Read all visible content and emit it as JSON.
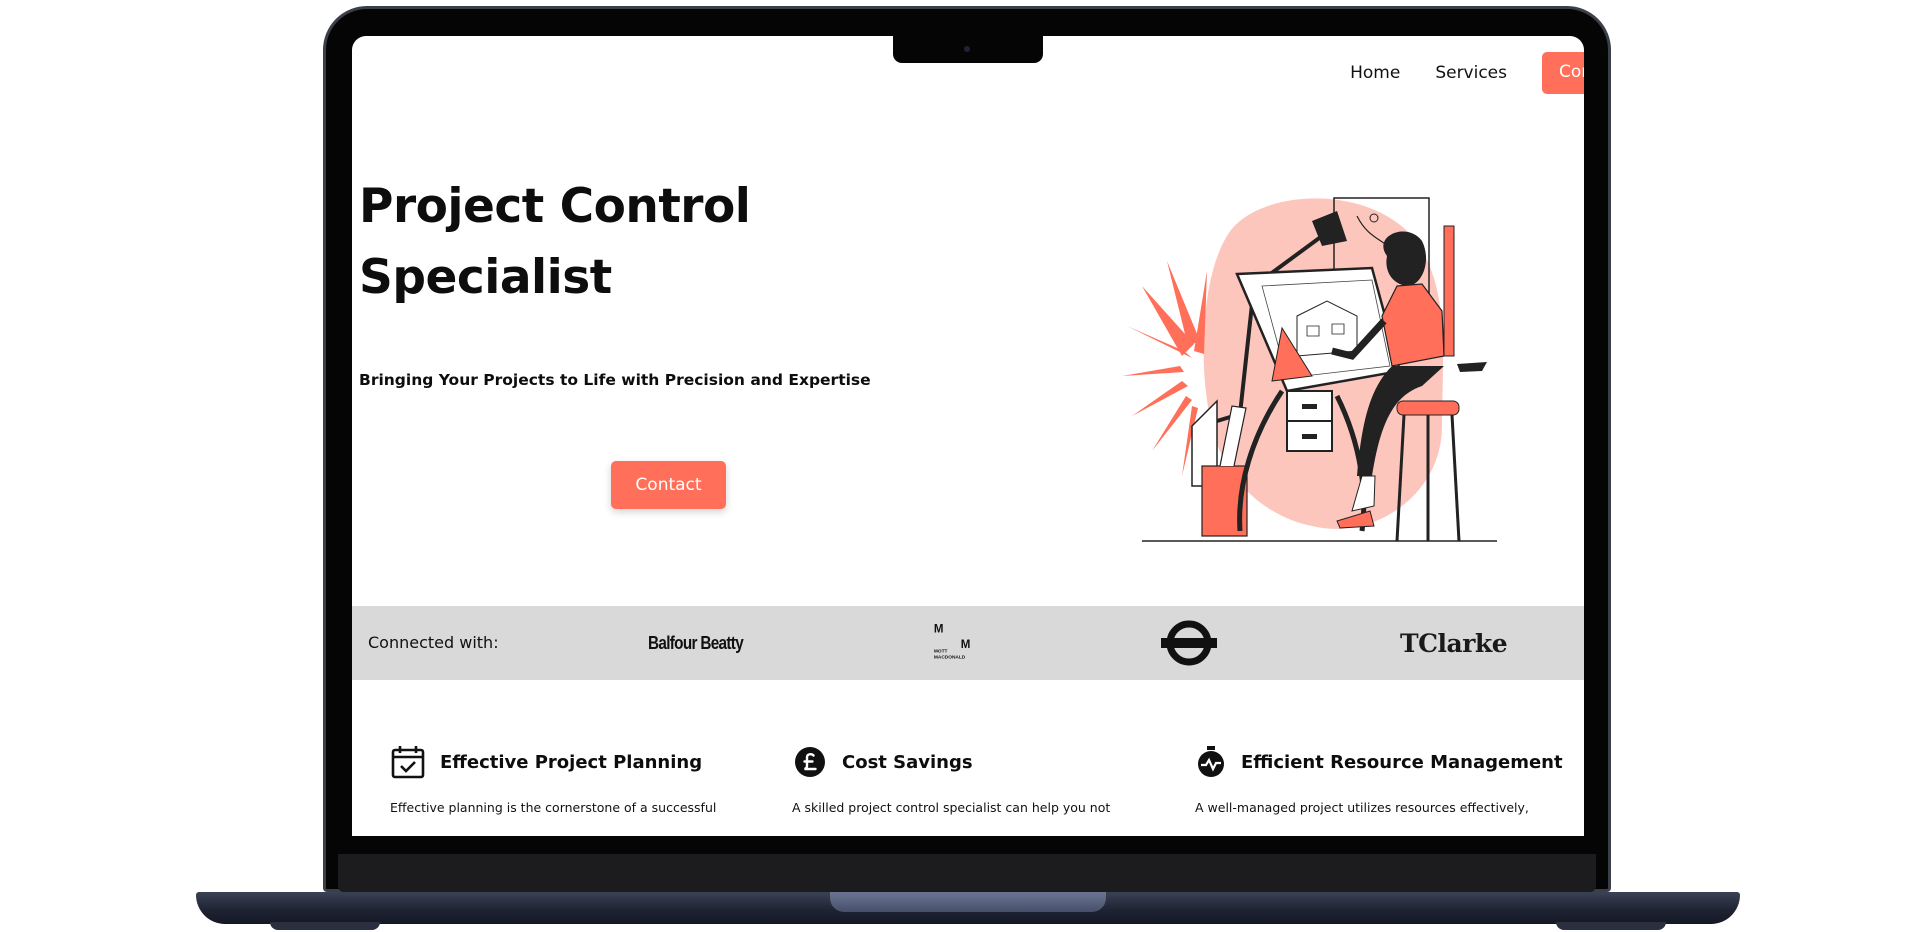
{
  "nav": {
    "home": "Home",
    "services": "Services",
    "contact": "Contact"
  },
  "hero": {
    "title_line1": "Project Control",
    "title_line2": "Specialist",
    "subtitle": "Bringing Your Projects to Life with Precision and Expertise",
    "contact_button": "Contact"
  },
  "partners": {
    "label": "Connected with:",
    "balfour": "Balfour Beatty",
    "mott_m": "M",
    "mott_text1": "MOTT",
    "mott_text2": "MACDONALD",
    "tclarke": "TClarke"
  },
  "features": [
    {
      "icon": "calendar-check-icon",
      "title": "Effective Project Planning",
      "text": "Effective planning is the cornerstone of a successful"
    },
    {
      "icon": "pound-coin-icon",
      "title": "Cost Savings",
      "text": "A skilled project control specialist can help you not"
    },
    {
      "icon": "stopwatch-icon",
      "title": "Efficient Resource Management",
      "text": "A well-managed project utilizes resources effectively,"
    }
  ],
  "colors": {
    "accent": "#ff6f5a",
    "accent_light": "#fdc6bd",
    "partner_band": "#d9d9d9",
    "text": "#0d0d0d"
  }
}
